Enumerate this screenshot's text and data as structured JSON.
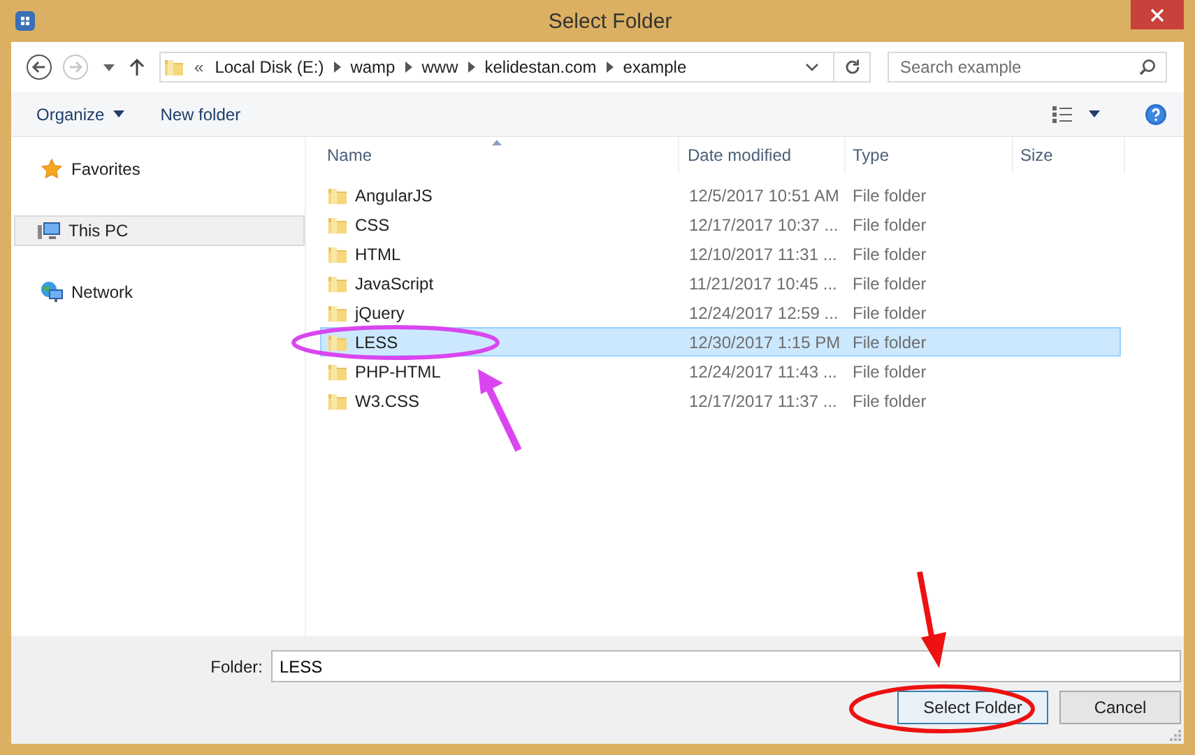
{
  "window": {
    "title": "Select Folder"
  },
  "address_bar": {
    "overflow": "«",
    "path": [
      "Local Disk (E:)",
      "wamp",
      "www",
      "kelidestan.com",
      "example"
    ]
  },
  "search": {
    "placeholder": "Search example"
  },
  "toolbar": {
    "buttons": [
      {
        "label": "Organize",
        "dropdown": true
      },
      {
        "label": "New folder",
        "dropdown": false
      }
    ]
  },
  "navigation": [
    {
      "label": "Favorites",
      "selected": false
    },
    {
      "label": "This PC",
      "selected": true
    },
    {
      "label": "Network",
      "selected": false
    }
  ],
  "table": {
    "columns": [
      {
        "label": "Name",
        "sorted": true
      },
      {
        "label": "Date modified",
        "sorted": false
      },
      {
        "label": "Type",
        "sorted": false
      },
      {
        "label": "Size",
        "sorted": false
      }
    ],
    "rows": [
      {
        "name": "AngularJS",
        "date": "12/5/2017 10:51 AM",
        "type": "File folder",
        "selected": false
      },
      {
        "name": "CSS",
        "date": "12/17/2017 10:37 ...",
        "type": "File folder",
        "selected": false
      },
      {
        "name": "HTML",
        "date": "12/10/2017 11:31 ...",
        "type": "File folder",
        "selected": false
      },
      {
        "name": "JavaScript",
        "date": "11/21/2017 10:45 ...",
        "type": "File folder",
        "selected": false
      },
      {
        "name": "jQuery",
        "date": "12/24/2017 12:59 ...",
        "type": "File folder",
        "selected": false
      },
      {
        "name": "LESS",
        "date": "12/30/2017 1:15 PM",
        "type": "File folder",
        "selected": true
      },
      {
        "name": "PHP-HTML",
        "date": "12/24/2017 11:43 ...",
        "type": "File folder",
        "selected": false
      },
      {
        "name": "W3.CSS",
        "date": "12/17/2017 11:37 ...",
        "type": "File folder",
        "selected": false
      }
    ]
  },
  "folder_field": {
    "label": "Folder:",
    "value": "LESS"
  },
  "buttons": [
    {
      "label": "Select Folder",
      "default": true
    },
    {
      "label": "Cancel",
      "default": false
    }
  ],
  "annotations": [
    {
      "kind": "ellipse",
      "color": "#d946ef"
    },
    {
      "kind": "arrow",
      "color": "#d946ef"
    },
    {
      "kind": "arrow",
      "color": "#ee1111"
    },
    {
      "kind": "ellipse",
      "color": "#ee1111"
    }
  ]
}
